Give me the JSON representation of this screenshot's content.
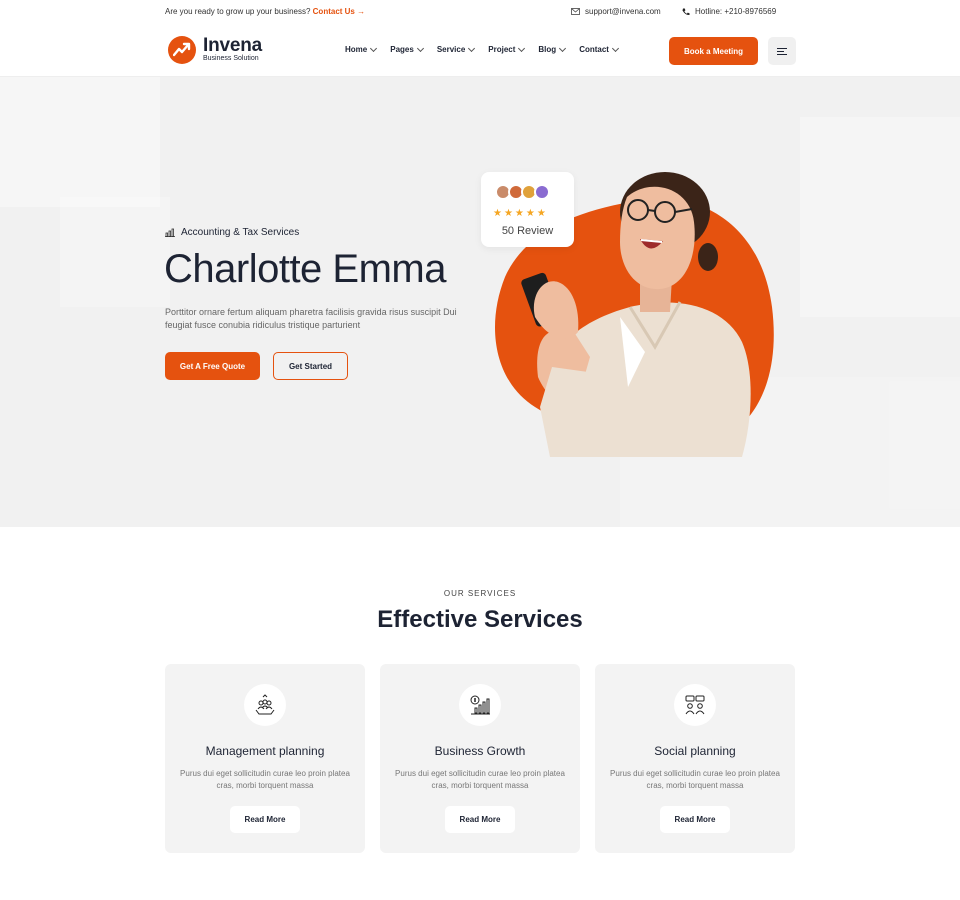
{
  "topbar": {
    "message": "Are you ready to grow up your business?",
    "contact_link": "Contact Us",
    "email": "support@invena.com",
    "hotline": "Hotline: +210-8976569"
  },
  "brand": {
    "name": "Invena",
    "tagline": "Business Solution",
    "accent": "#e5520f"
  },
  "nav": {
    "items": [
      {
        "label": "Home"
      },
      {
        "label": "Pages"
      },
      {
        "label": "Service"
      },
      {
        "label": "Project"
      },
      {
        "label": "Blog"
      },
      {
        "label": "Contact"
      }
    ],
    "cta": "Book a Meeting"
  },
  "hero": {
    "eyebrow": "Accounting & Tax Services",
    "title": "Charlotte Emma",
    "description": "Porttitor ornare fertum aliquam pharetra facilisis gravida risus suscipit Dui feugiat fusce conubia ridiculus tristique parturient",
    "primary_button": "Get A Free Quote",
    "secondary_button": "Get Started",
    "review": {
      "stars": 5,
      "text": "50 Review"
    }
  },
  "services": {
    "eyebrow": "OUR SERVICES",
    "title": "Effective Services",
    "cards": [
      {
        "title": "Management planning",
        "description": "Purus dui eget sollicitudin curae leo proin platea cras, morbi torquent massa",
        "button": "Read More",
        "icon": "team-management-icon"
      },
      {
        "title": "Business Growth",
        "description": "Purus dui eget sollicitudin curae leo proin platea cras, morbi torquent massa",
        "button": "Read More",
        "icon": "growth-chart-icon"
      },
      {
        "title": "Social planning",
        "description": "Purus dui eget sollicitudin curae leo proin platea cras, morbi torquent massa",
        "button": "Read More",
        "icon": "people-chat-icon"
      }
    ]
  }
}
